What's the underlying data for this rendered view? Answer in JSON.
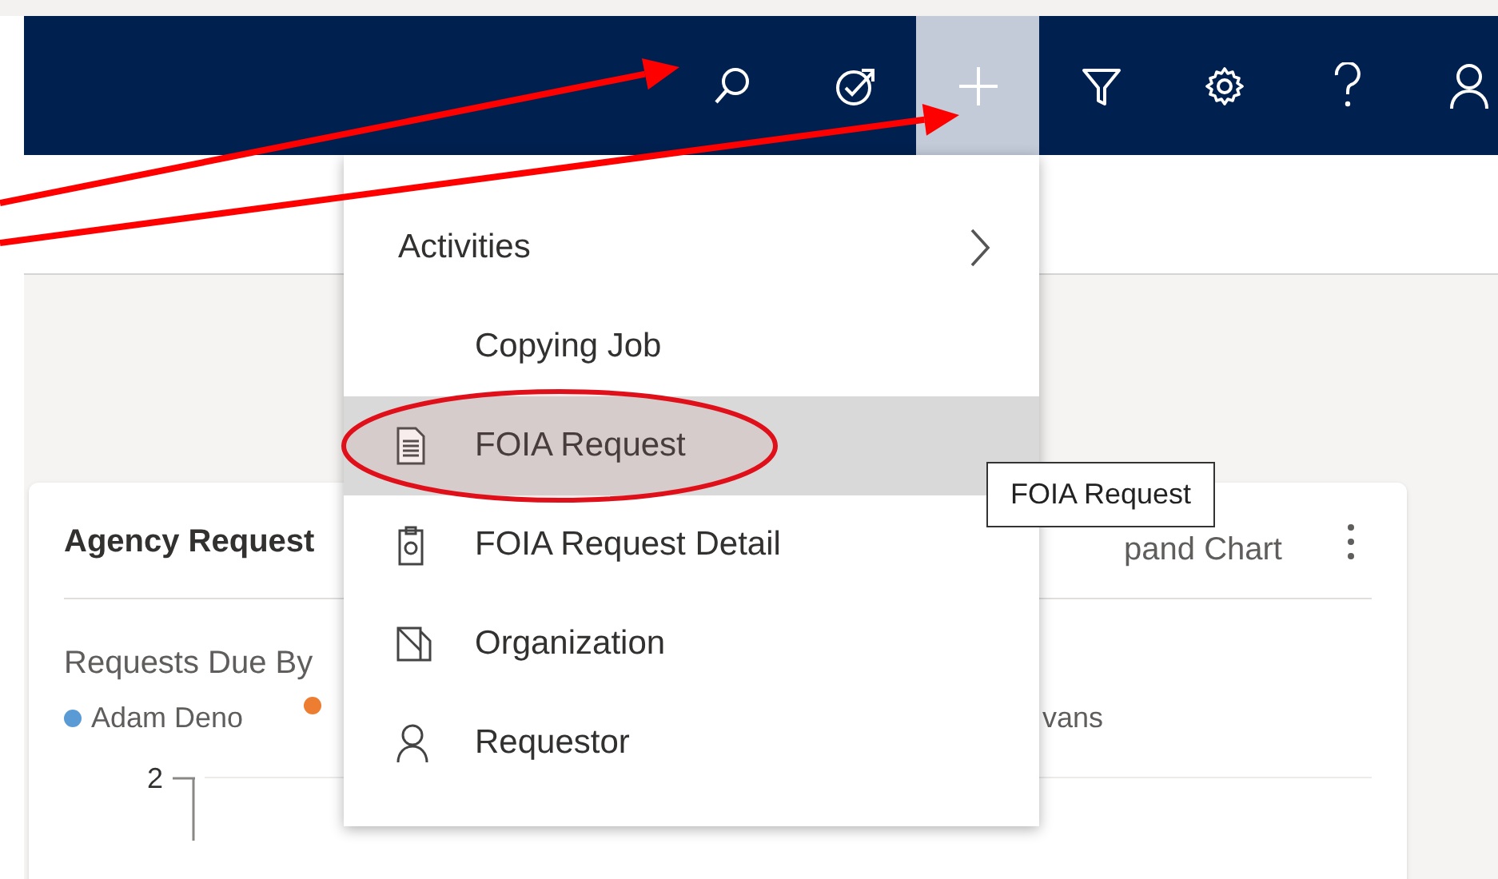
{
  "top_bar": {
    "buttons": [
      {
        "kind": "search",
        "selected": false
      },
      {
        "kind": "target",
        "selected": false
      },
      {
        "kind": "plus",
        "selected": true
      },
      {
        "kind": "filter",
        "selected": false
      },
      {
        "kind": "settings",
        "selected": false
      },
      {
        "kind": "help",
        "selected": false
      },
      {
        "kind": "person",
        "selected": false
      }
    ]
  },
  "new_menu": {
    "items": [
      {
        "label": "Activities",
        "kind": "submenu",
        "selected": false
      },
      {
        "label": "Copying Job",
        "kind": "plain",
        "selected": false
      },
      {
        "label": "FOIA Request",
        "kind": "document",
        "selected": true
      },
      {
        "label": "FOIA Request Detail",
        "kind": "clipboard",
        "selected": false
      },
      {
        "label": "Organization",
        "kind": "organization",
        "selected": false
      },
      {
        "label": "Requestor",
        "kind": "person",
        "selected": false
      }
    ]
  },
  "tooltip": {
    "text": "FOIA Request"
  },
  "card": {
    "title": "Agency Request",
    "action": "pand Chart",
    "subtitle": "Requests Due By",
    "legend": [
      {
        "label": "Adam Deno",
        "color": "#5b9bd5"
      },
      {
        "color": "#ed7d31"
      },
      {
        "label": "vans"
      }
    ],
    "y_tick": "2"
  },
  "annotations": [
    {
      "kind": "arrow"
    },
    {
      "kind": "arrow"
    },
    {
      "kind": "ellipse"
    }
  ]
}
